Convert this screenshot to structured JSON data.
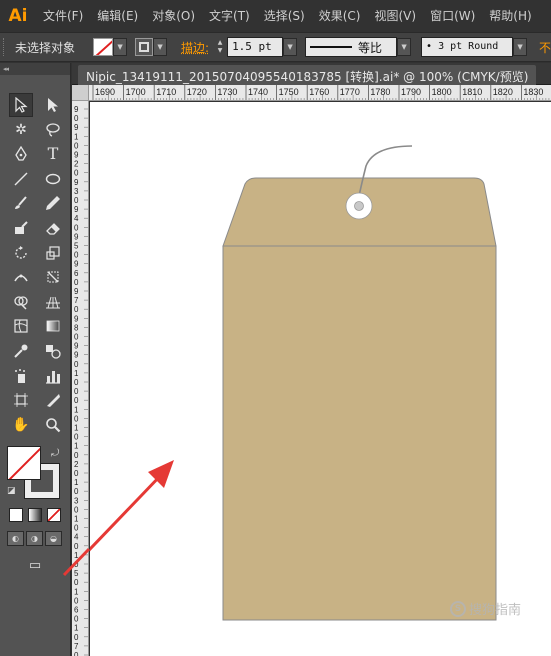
{
  "app": {
    "logo": "Ai"
  },
  "menu": [
    "文件(F)",
    "编辑(E)",
    "对象(O)",
    "文字(T)",
    "选择(S)",
    "效果(C)",
    "视图(V)",
    "窗口(W)",
    "帮助(H)"
  ],
  "control": {
    "selection_status": "未选择对象",
    "stroke_label": "描边:",
    "stroke_weight": "1.5 pt",
    "profile_label": "等比",
    "brush_label": "• 3 pt Round",
    "opacity_label": "不"
  },
  "toolbar": {
    "header": "◂◂"
  },
  "document": {
    "tab_title": "Nipic_13419111_20150704095540183785  [转换].ai* @ 100% (CMYK/预览)"
  },
  "ruler": {
    "top_ticks": [
      "1690",
      "1700",
      "1710",
      "1720",
      "1730",
      "1740",
      "1750",
      "1760",
      "1770",
      "1780",
      "1790",
      "1800",
      "1810",
      "1820",
      "1830",
      "1840"
    ],
    "left_ticks": [
      "9",
      "0",
      "9",
      "1",
      "0",
      "9",
      "2",
      "0",
      "9",
      "3",
      "0",
      "9",
      "4",
      "0",
      "9",
      "5",
      "0",
      "9",
      "6",
      "0",
      "9",
      "7",
      "0",
      "9",
      "8",
      "0",
      "9",
      "9",
      "0",
      "1",
      "0",
      "0",
      "0",
      "1",
      "0",
      "1",
      "0",
      "1",
      "0",
      "2",
      "0",
      "1",
      "0",
      "3",
      "0",
      "1",
      "0",
      "4",
      "0",
      "1",
      "0",
      "5",
      "0",
      "1",
      "0",
      "6",
      "0",
      "1",
      "0",
      "7",
      "0"
    ]
  },
  "watermark": "搜狗指南",
  "colors": {
    "envelope": "#c8b285",
    "envelope_stroke": "#8a8a8a",
    "accent_orange": "#ff9a00",
    "arrow_red": "#e53935"
  }
}
